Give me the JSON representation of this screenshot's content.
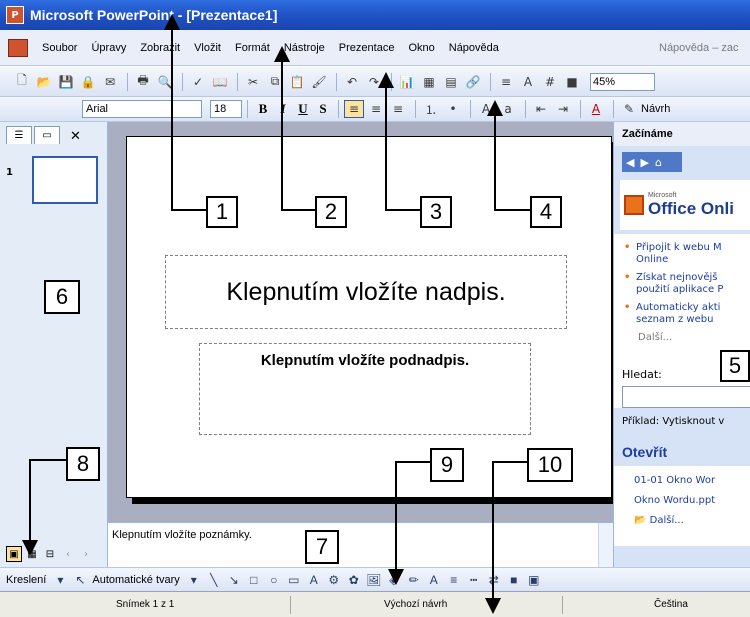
{
  "window": {
    "title": "Microsoft PowerPoint - [Prezentace1]"
  },
  "menu": {
    "items": [
      "Soubor",
      "Úpravy",
      "Zobrazit",
      "Vložit",
      "Formát",
      "Nástroje",
      "Prezentace",
      "Okno",
      "Nápověda"
    ],
    "help_placeholder": "Nápověda – zac"
  },
  "standard_toolbar": {
    "zoom": "45%"
  },
  "format_toolbar": {
    "font": "Arial",
    "size": "18",
    "design_button": "Návrh"
  },
  "left_pane": {
    "slide_number": "1"
  },
  "slide": {
    "title_placeholder": "Klepnutím vložíte nadpis.",
    "subtitle_placeholder": "Klepnutím vložíte podnadpis."
  },
  "notes": {
    "placeholder": "Klepnutím vložíte poznámky."
  },
  "task_pane": {
    "title": "Začínáme",
    "logo_small": "Microsoft",
    "logo_text": "Office Onli",
    "links": [
      "Připojit k webu M",
      "Online",
      "Získat nejnovějš",
      "použití aplikace P",
      "Automaticky akti",
      "seznam z webu"
    ],
    "more": "Další...",
    "search_label": "Hledat:",
    "example": "Příklad: Vytisknout v",
    "open_heading": "Otevřít",
    "open_items": [
      "01-01 Okno Wor",
      "Okno Wordu.ppt",
      "Další..."
    ]
  },
  "drawing_toolbar": {
    "draw_label": "Kreslení",
    "autoshapes_label": "Automatické tvary"
  },
  "status_bar": {
    "slide": "Snímek 1 z 1",
    "design": "Výchozí návrh",
    "language": "Čeština"
  },
  "callouts": [
    "1",
    "2",
    "3",
    "4",
    "5",
    "6",
    "7",
    "8",
    "9",
    "10"
  ]
}
